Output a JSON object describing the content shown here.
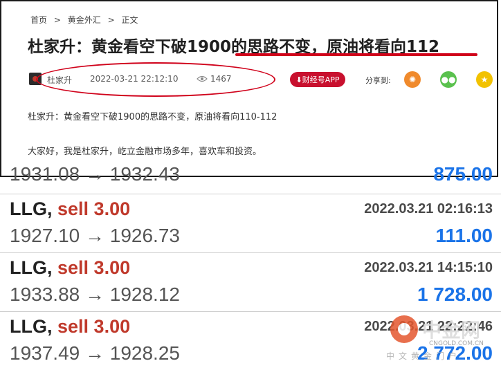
{
  "breadcrumb": [
    "首页",
    ">",
    "黄金外汇",
    ">",
    "正文"
  ],
  "article": {
    "title": "杜家升：黄金看空下破1900的思路不变，原油将看向112",
    "author": "杜家升",
    "datetime": "2022-03-21 22:12:10",
    "views": "1467",
    "app_button": "财经号APP",
    "share_label": "分享到:",
    "paragraphs": [
      "杜家升：黄金看空下破1900的思路不变，原油将看向110-112",
      "大家好，我是杜家升，屹立金融市场多年，喜欢车和投资。"
    ]
  },
  "share_icons": [
    "weibo-icon",
    "wechat-icon",
    "qzone-icon"
  ],
  "trades": {
    "partial_row": {
      "price": "1931.08 → 1932.43",
      "profit": "875.00"
    },
    "rows": [
      {
        "symbol": "LLG,",
        "action": "sell 3.00",
        "time": "2022.03.21 02:16:13",
        "price": "1927.10 → 1926.73",
        "profit": "111.00"
      },
      {
        "symbol": "LLG,",
        "action": "sell 3.00",
        "time": "2022.03.21 14:15:10",
        "price": "1933.88 → 1928.12",
        "profit": "1 728.00"
      },
      {
        "symbol": "LLG,",
        "action": "sell 3.00",
        "time": "2022.03.21 22:22:46",
        "price": "1937.49 → 1928.25",
        "profit": "2 772.00"
      }
    ]
  },
  "watermark": {
    "name": "中金网",
    "url": "CNGOLD.COM.CN",
    "subtitle": "中文黄金门户"
  },
  "colors": {
    "accent_red": "#d0021b",
    "sell_red": "#c0392b",
    "profit_blue": "#1a73e8"
  }
}
